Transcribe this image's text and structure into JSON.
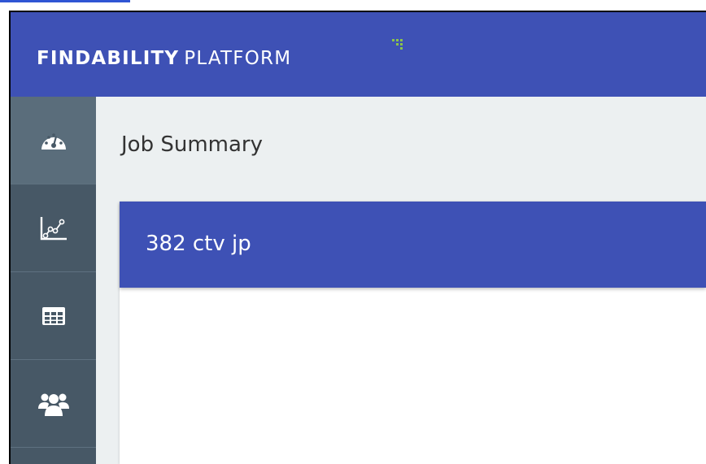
{
  "header": {
    "brand_bold": "FINDABILITY",
    "brand_light": "PLATFORM",
    "brand_color": "#3e51b5",
    "brand_mark_color": "#8bc34a"
  },
  "sidebar": {
    "items": [
      {
        "name": "dashboard",
        "icon": "gauge-icon",
        "active": true
      },
      {
        "name": "analytics",
        "icon": "line-chart-icon",
        "active": false
      },
      {
        "name": "tables",
        "icon": "table-icon",
        "active": false
      },
      {
        "name": "users",
        "icon": "users-icon",
        "active": false
      }
    ],
    "background": "#475866"
  },
  "main": {
    "page_title": "Job Summary",
    "card": {
      "title": "382 ctv jp"
    }
  }
}
